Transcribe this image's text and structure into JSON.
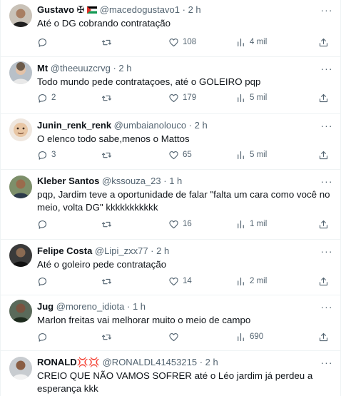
{
  "more_glyph": "···",
  "tweets": [
    {
      "name": "Gustavo ✠",
      "handle": "@macedogustavo1",
      "sep": "·",
      "time": "2 h",
      "text": "Até o DG cobrando contratação",
      "replies": "",
      "retweets": "",
      "likes": "108",
      "views": "4 mil",
      "avatar": "avatar-gustavo"
    },
    {
      "name": "Mt",
      "handle": "@theeuuzcrvg",
      "sep": "·",
      "time": "2 h",
      "text": "Todo mundo pede contrataçoes, até o GOLEIRO pqp",
      "replies": "2",
      "retweets": "",
      "likes": "179",
      "views": "5 mil",
      "avatar": "avatar-mt"
    },
    {
      "name": "Junin_renk_renk",
      "handle": "@umbaianolouco",
      "sep": "·",
      "time": "2 h",
      "text": "O elenco todo sabe,menos o Mattos",
      "replies": "3",
      "retweets": "",
      "likes": "65",
      "views": "5 mil",
      "avatar": "avatar-junin"
    },
    {
      "name": "Kleber Santos",
      "handle": "@kssouza_23",
      "sep": "·",
      "time": "1 h",
      "text": "pqp, Jardim teve a oportunidade de falar \"falta um cara como você no meio, volta DG\" kkkkkkkkkkk",
      "replies": "",
      "retweets": "",
      "likes": "16",
      "views": "1 mil",
      "avatar": "avatar-kleber"
    },
    {
      "name": "Felipe Costa",
      "handle": "@Lipi_zxx77",
      "sep": "·",
      "time": "2 h",
      "text": "Até o goleiro pede contratação",
      "replies": "",
      "retweets": "",
      "likes": "14",
      "views": "2 mil",
      "avatar": "avatar-felipe"
    },
    {
      "name": "Jug",
      "handle": "@moreno_idiota",
      "sep": "·",
      "time": "1 h",
      "text": "Marlon freitas vai melhorar muito o meio de campo",
      "replies": "",
      "retweets": "",
      "likes": "",
      "views": "690",
      "avatar": "avatar-jug"
    },
    {
      "name": "RONALD💢💢",
      "handle": "@RONALDL41453215",
      "sep": "·",
      "time": "2 h",
      "text": "CREIO QUE NÃO VAMOS SOFRER até o Léo jardim já perdeu a esperança kkk",
      "replies": "",
      "retweets": "",
      "likes": "",
      "views": "",
      "avatar": "avatar-ronald"
    }
  ]
}
